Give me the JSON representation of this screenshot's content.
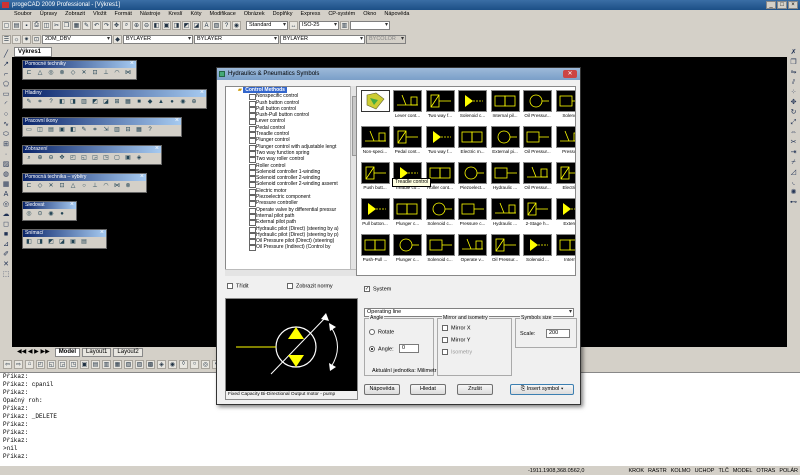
{
  "app": {
    "title": "progeCAD 2009 Professional - [Výkres1]"
  },
  "menu": [
    "Soubor",
    "Úpravy",
    "Zobrazit",
    "Vložit",
    "Formát",
    "Nástroje",
    "Kreslí",
    "Kóty",
    "Modifikace",
    "Obrázek",
    "Doplňky",
    "Express",
    "CP-systém",
    "Okno",
    "Nápověda"
  ],
  "toolbar": {
    "style_combo": "Standard",
    "dim_combo": "ISO-25",
    "layer_combo": "2DM_DBV",
    "color_combo": "BYLAYER",
    "linetype_combo": "BYLAYER",
    "lineweight_combo": "BYLAYER",
    "plotstyle_combo": "BYCOLOR"
  },
  "drawing_tab": "Výkres1",
  "floating_toolbars": [
    "Pomocné techniky",
    "Hladiny",
    "Pracovní ikony",
    "Zobrazení",
    "Pomocná technika – výběry",
    "Sledovat",
    "Snímací"
  ],
  "layout_tabs": [
    "Model",
    "Layout1",
    "Layout2"
  ],
  "command_lines": [
    "Příkaz:",
    "Příkaz: cpanil",
    "Příkaz:",
    "Opačný roh:",
    "Příkaz:",
    "Příkaz: _DELETE",
    "Příkaz:",
    "Příkaz:",
    "Příkaz:",
    " >nil",
    "Příkaz:"
  ],
  "status": {
    "coords": "-1911.1908,368.0562,0",
    "modes": [
      "KROK",
      "RASTR",
      "KOLMO",
      "UCHOP",
      "TLČ",
      "MODEL",
      "OTRAS",
      "POLÁR"
    ]
  },
  "dialog": {
    "title": "Hydraulics & Pneumatics Symbols",
    "tree_root": "Control Methods",
    "tree_items": [
      "Nonspecific control",
      "Push button control",
      "Pull button control",
      "Push-Pull button control",
      "Lever control",
      "Pedal control",
      "Treadle control",
      "Plunger control",
      "Plunger control with adjustable lengt",
      "Two way function spring",
      "Two way roller control",
      "Roller control",
      "Solenoid controller 1-winding",
      "Solenoid controller 2-winding",
      "Solenoid controller 2-winding assemt",
      "Electric motor",
      "Piezoelectric component",
      "Pressure controller",
      "Operate valve by differential pressur",
      "Internal pilot path",
      "External pilot path",
      "Hydraulic pilot (Direct) (steering by a)",
      "Hydraulic pilot (Direct) (steering by p)",
      "Oil Pressure pilot (Direct) (steering)",
      "Oil Pressure (Indirect) (Control by"
    ],
    "symbols": [
      "",
      "Lever cont...",
      "Two way f...",
      "Solenoid c...",
      "Internal pil...",
      "Oil Pressur...",
      "Solenoi",
      "Non-speci...",
      "Pedal cont...",
      "Two way f...",
      "Electric m...",
      "External pi...",
      "Oil Pressur...",
      "Pressur",
      "Push butt...",
      "Treadle co...",
      "Roller cont...",
      "Piezoelect...",
      "Hydraulic ...",
      "Oil Pressur...",
      "Electric",
      "Pull button...",
      "Plunger c...",
      "Solenoid c...",
      "Pressure c...",
      "Hydraulic ...",
      "2-Stage h...",
      "Extern",
      "Push-Pull ...",
      "Plunger c...",
      "Solenoid c...",
      "Operate v...",
      "Oil Pressur...",
      "Solenoid ...",
      "Intern"
    ],
    "tooltip": "Treadle control",
    "tridit_label": "Třídit",
    "zobrazit_label": "Zobrazit normy",
    "system_label": "System",
    "system_value": "Operating line",
    "angle": {
      "legend": "Angle",
      "rotate": "Rotate",
      "angle_label": "Angle:",
      "angle_value": "0"
    },
    "mirror": {
      "legend": "Mirror and isometry",
      "mirror_x": "Mirror X",
      "mirror_y": "Mirror Y",
      "isometry": "Isometry"
    },
    "symbols_size": {
      "legend": "Symbols size",
      "scale_label": "Scale:",
      "scale_value": "200"
    },
    "units_label": "Aktuální jednotka: Milimetr",
    "preview_caption": "Fixed Capacity Bi-Directional Output motor - pump",
    "buttons": {
      "help": "Nápověda",
      "search": "Hledat",
      "cancel": "Zrušit",
      "insert": "Insert symbol"
    }
  }
}
